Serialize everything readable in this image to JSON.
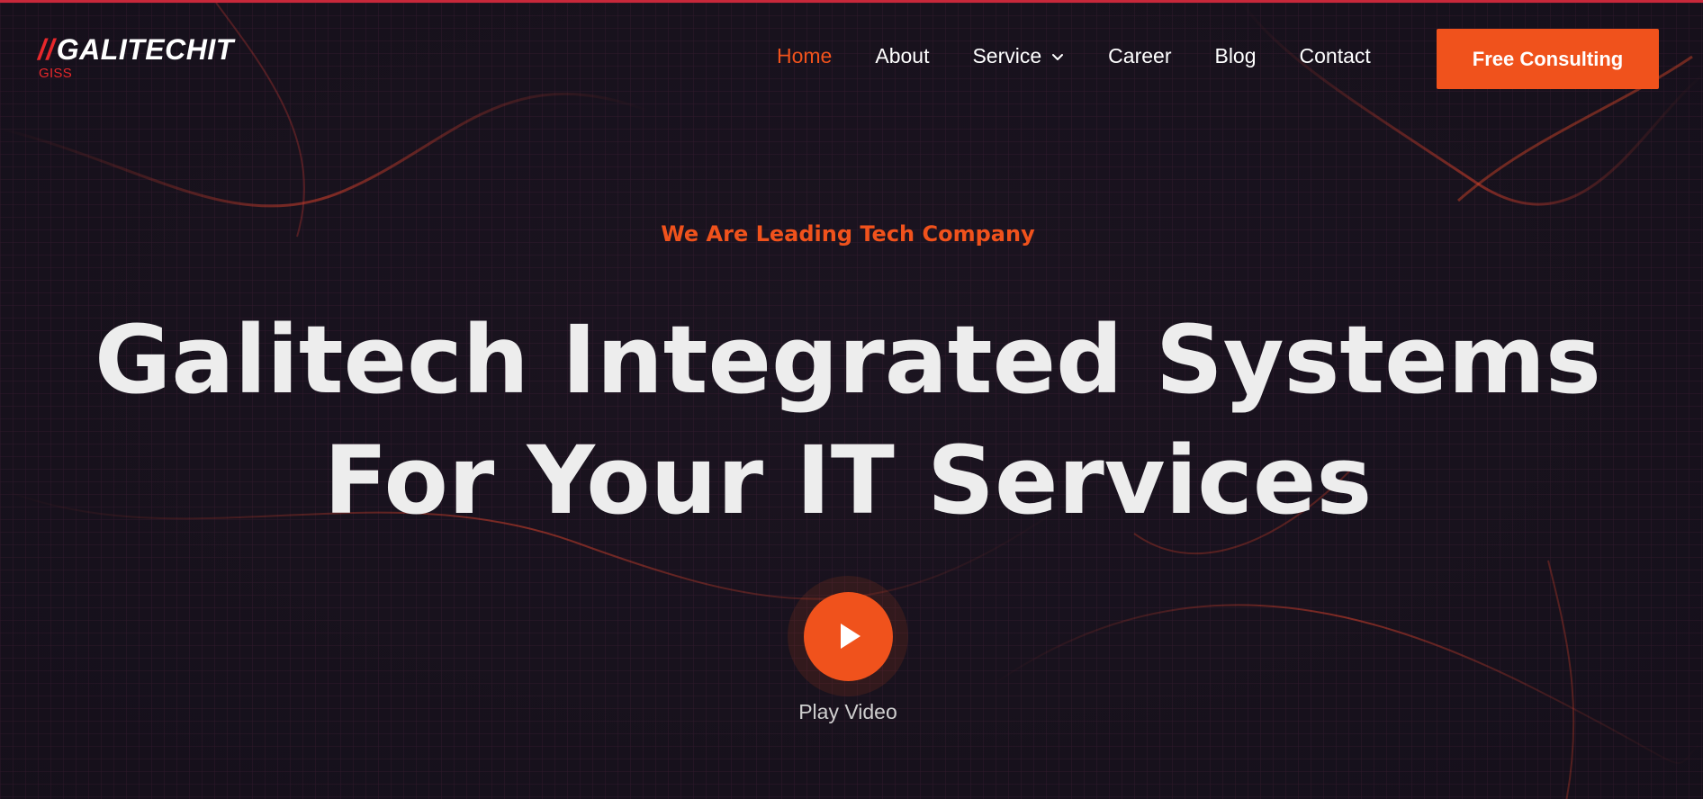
{
  "brand": {
    "logo_slashes": "//",
    "logo_text": "GALITECHIT",
    "logo_subtext": "GISS"
  },
  "nav": {
    "items": [
      {
        "label": "Home",
        "active": true
      },
      {
        "label": "About"
      },
      {
        "label": "Service",
        "has_dropdown": true
      },
      {
        "label": "Career"
      },
      {
        "label": "Blog"
      },
      {
        "label": "Contact"
      }
    ],
    "cta_label": "Free Consulting"
  },
  "hero": {
    "tagline": "We Are Leading Tech Company",
    "headline_line1": "Galitech Integrated Systems",
    "headline_line2": "For Your IT Services",
    "play_label": "Play Video"
  },
  "icons": {
    "dropdown": "chevron-down-icon",
    "play": "play-icon"
  },
  "colors": {
    "accent": "#f0521c",
    "logo_red": "#e8272b",
    "background": "#1b1420",
    "text_primary": "#ededed"
  }
}
